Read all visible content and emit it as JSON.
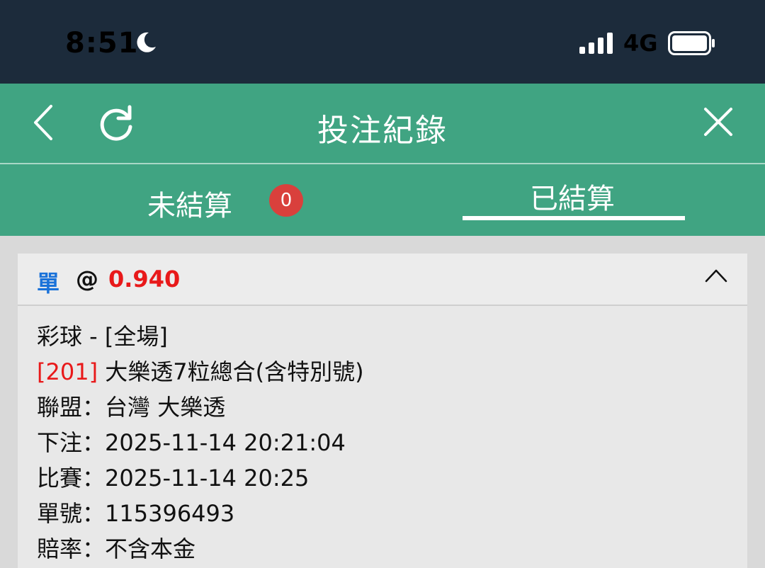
{
  "status_bar": {
    "time": "8:51",
    "network": "4G"
  },
  "header": {
    "title": "投注紀錄"
  },
  "tabs": {
    "unsettled_label": "未結算",
    "unsettled_count": "0",
    "settled_label": "已結算"
  },
  "bet": {
    "type": "單",
    "at": "@",
    "odds": "0.940",
    "market": "彩球 - [全場]",
    "code": "[201]",
    "selection": "大樂透7粒總合(含特別號)",
    "league_label": "聯盟：",
    "league": "台灣 大樂透",
    "bet_time_label": "下注：",
    "bet_time": "2025-11-14 20:21:04",
    "match_time_label": "比賽：",
    "match_time": "2025-11-14 20:25",
    "ticket_label": "單號：",
    "ticket_no": "115396493",
    "odds_type_label": "賠率：",
    "odds_type": "不含本金"
  },
  "colors": {
    "status_bar": "#1c2b3b",
    "header": "#40a482",
    "badge": "#d9403c",
    "odds": "#e8191a",
    "bet_type": "#1a72d9"
  }
}
